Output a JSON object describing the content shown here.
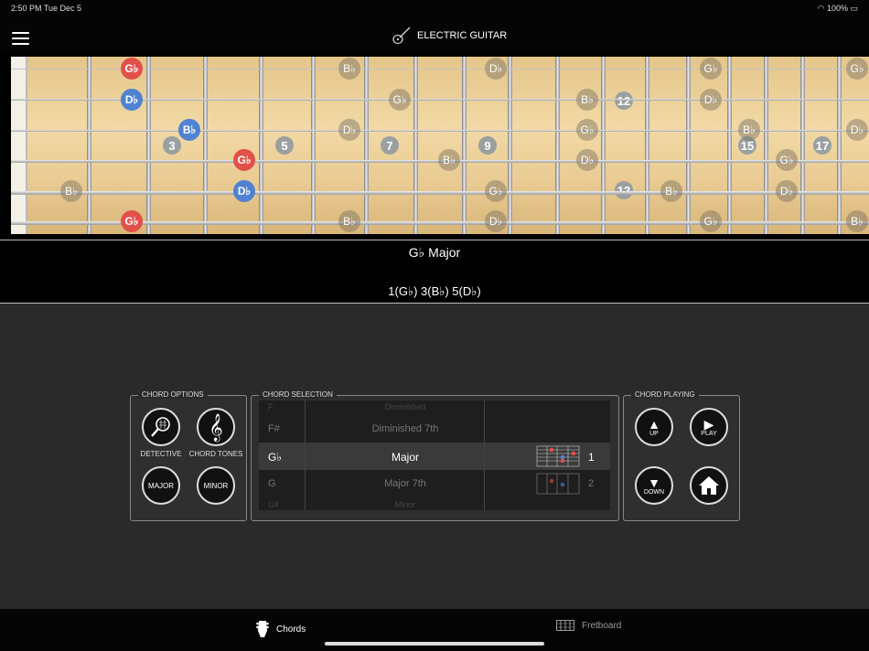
{
  "status": {
    "time": "2:50 PM  Tue Dec 5",
    "battery": "100%"
  },
  "header": {
    "title": "ELECTRIC GUITAR"
  },
  "fretboard": {
    "fret_markers": [
      "3",
      "5",
      "7",
      "9",
      "12",
      "12",
      "15",
      "17"
    ],
    "notes": [
      {
        "label": "G♭",
        "type": "red"
      },
      {
        "label": "D♭",
        "type": "blue"
      },
      {
        "label": "B♭",
        "type": "blue"
      },
      {
        "label": "G♭",
        "type": "red"
      },
      {
        "label": "D♭",
        "type": "blue"
      },
      {
        "label": "G♭",
        "type": "red"
      },
      {
        "label": "B♭",
        "type": "ghost"
      },
      {
        "label": "D♭",
        "type": "ghost"
      },
      {
        "label": "G♭",
        "type": "ghost"
      },
      {
        "label": "B♭",
        "type": "ghost"
      },
      {
        "label": "D♭",
        "type": "ghost"
      },
      {
        "label": "B♭",
        "type": "ghost"
      },
      {
        "label": "G♭",
        "type": "ghost"
      },
      {
        "label": "G♭",
        "type": "ghost"
      },
      {
        "label": "D♭",
        "type": "ghost"
      },
      {
        "label": "B♭",
        "type": "ghost"
      },
      {
        "label": "G♭",
        "type": "ghost"
      },
      {
        "label": "D♭",
        "type": "ghost"
      },
      {
        "label": "G♭",
        "type": "ghost"
      },
      {
        "label": "D♭",
        "type": "ghost"
      },
      {
        "label": "B♭",
        "type": "ghost"
      },
      {
        "label": "G♭",
        "type": "ghost"
      },
      {
        "label": "B♭",
        "type": "ghost"
      },
      {
        "label": "D♭",
        "type": "ghost"
      },
      {
        "label": "B♭",
        "type": "ghost"
      },
      {
        "label": "G♭",
        "type": "ghost"
      },
      {
        "label": "B♭",
        "type": "ghost"
      },
      {
        "label": "D♭",
        "type": "ghost"
      },
      {
        "label": "G♭",
        "type": "ghost"
      },
      {
        "label": "B♭",
        "type": "ghost"
      },
      {
        "label": "D♭",
        "type": "ghost"
      },
      {
        "label": "B♭",
        "type": "ghost"
      }
    ]
  },
  "info": {
    "chord_name": "G♭ Major",
    "tones": "1(G♭)   3(B♭)   5(D♭)"
  },
  "chord_options": {
    "title": "CHORD OPTIONS",
    "detective": "DETECTIVE",
    "chord_tones": "CHORD TONES",
    "major": "MAJOR",
    "minor": "MINOR"
  },
  "chord_selection": {
    "title": "CHORD SELECTION",
    "rows": [
      {
        "key": "F",
        "name": "Diminished",
        "num": ""
      },
      {
        "key": "F#",
        "name": "Diminished 7th",
        "num": ""
      },
      {
        "key": "G♭",
        "name": "Major",
        "num": "1"
      },
      {
        "key": "G",
        "name": "Major 7th",
        "num": "2"
      },
      {
        "key": "G#",
        "name": "Minor",
        "num": ""
      }
    ]
  },
  "chord_playing": {
    "title": "CHORD PLAYING",
    "up": "UP",
    "play": "PLAY",
    "down": "DOWN"
  },
  "tabs": {
    "chords": "Chords",
    "fretboard": "Fretboard"
  },
  "colors": {
    "root": "#e2504a",
    "tone": "#4f82d1",
    "background": "#2a2a2a"
  }
}
